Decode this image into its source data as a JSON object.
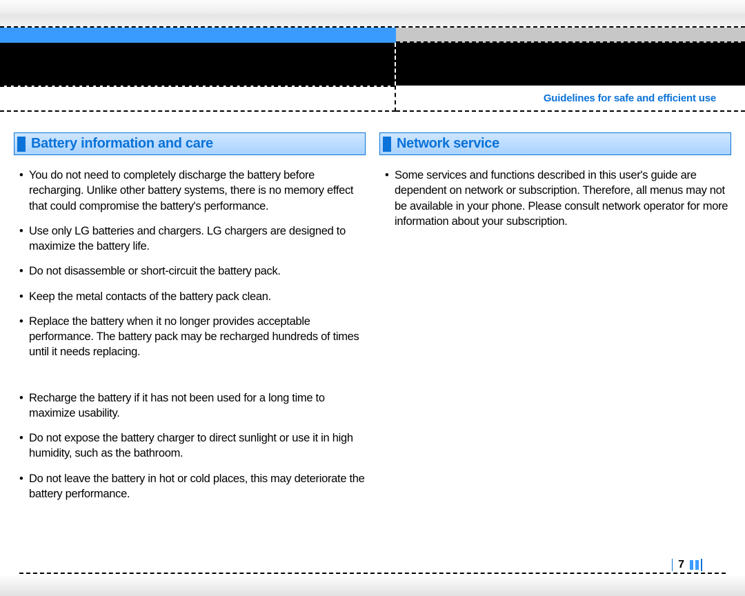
{
  "section_label": "Guidelines for safe and efficient use",
  "page_number": "7",
  "columns": {
    "left": {
      "heading": "Battery information and care",
      "group1": [
        "You do not need to completely discharge the battery before recharging. Unlike other battery systems, there is no memory effect that could compromise the battery's performance.",
        "Use only LG batteries and chargers. LG chargers are designed to maximize the battery life.",
        "Do not disassemble or short-circuit the battery pack.",
        "Keep the metal contacts of the battery pack clean.",
        "Replace the battery when it no longer provides acceptable performance. The battery pack may be recharged hundreds of times until it needs replacing."
      ],
      "group2": [
        "Recharge the battery if it has not been used for a long time to maximize usability.",
        "Do not expose the battery charger to direct sunlight or use it in high humidity, such as the bathroom.",
        "Do not leave the battery in hot or cold places, this may deteriorate the battery performance."
      ]
    },
    "right": {
      "heading": "Network service",
      "items": [
        "Some services and functions described in this user's guide are dependent on network or subscription. Therefore, all menus may not be available in your phone. Please consult network operator for more information about your subscription."
      ]
    }
  }
}
